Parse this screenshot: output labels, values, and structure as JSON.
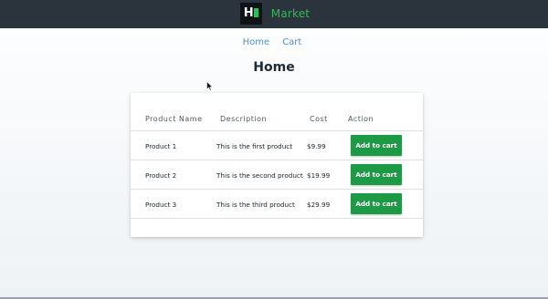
{
  "nav": {
    "logo_letter": "H",
    "brand": "Market",
    "links": [
      {
        "label": "Home"
      },
      {
        "label": "Cart"
      }
    ]
  },
  "page": {
    "title": "Home"
  },
  "table": {
    "headers": [
      "Product Name",
      "Description",
      "Cost",
      "Action"
    ],
    "rows": [
      {
        "name": "Product 1",
        "description": "This is the first product",
        "cost": "$9.99",
        "action": "Add to cart"
      },
      {
        "name": "Product 2",
        "description": "This is the second product",
        "cost": "$19.99",
        "action": "Add to cart"
      },
      {
        "name": "Product 3",
        "description": "This is the third product",
        "cost": "$29.99",
        "action": "Add to cart"
      }
    ]
  },
  "colors": {
    "navbar": "#2b333d",
    "brand_green": "#2ebd59",
    "button_green": "#1d9a45",
    "link_blue": "#4a90d9"
  }
}
